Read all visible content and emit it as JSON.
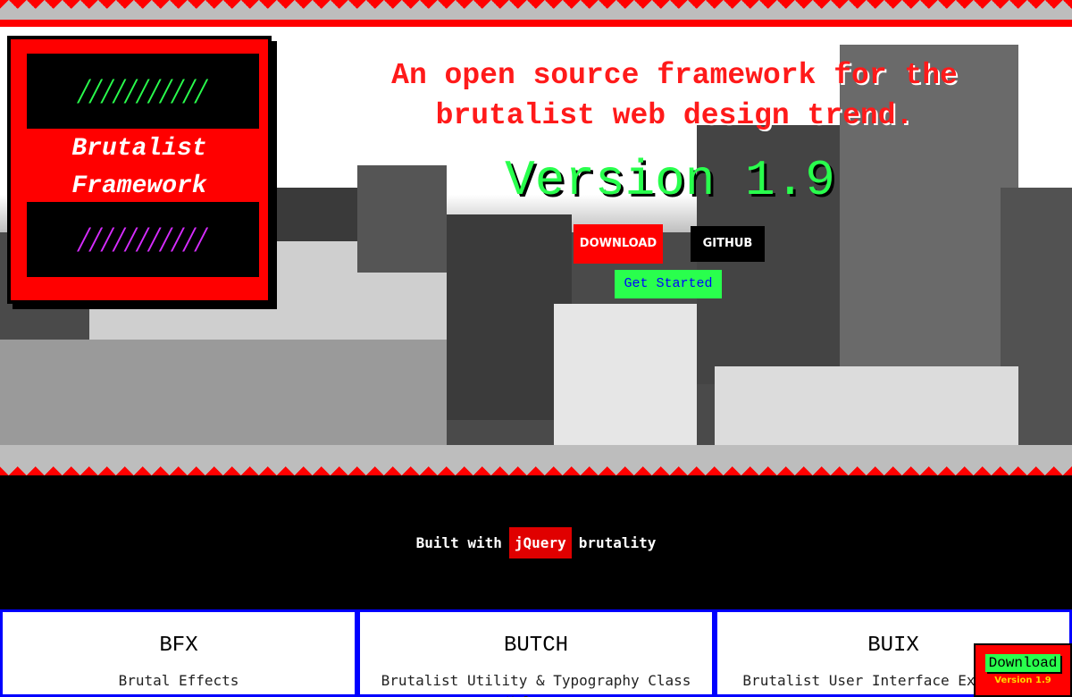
{
  "logo": {
    "slashes_top": "///////////",
    "title_line1": "Brutalist",
    "title_line2": "Framework",
    "slashes_bottom": "///////////"
  },
  "hero": {
    "tagline_line1": "An open source framework for the",
    "tagline_line2": "brutalist web design trend.",
    "version": "Version 1.9",
    "download_label": "DOWNLOAD",
    "github_label": "GITHUB",
    "get_started_label": "Get Started"
  },
  "built_with": {
    "prefix": "Built with",
    "highlight": "jQuery",
    "suffix": "brutality"
  },
  "cards": [
    {
      "title": "BFX",
      "subtitle": "Brutal Effects"
    },
    {
      "title": "BUTCH",
      "subtitle": "Brutalist Utility & Typography Class Helpers"
    },
    {
      "title": "BUIX",
      "subtitle": "Brutalist User Interface Extensions"
    }
  ],
  "floating_download": {
    "label": "Download",
    "version": "Version 1.9"
  },
  "colors": {
    "accent_red": "#ff0000",
    "accent_green": "#29ff4d",
    "accent_magenta": "#d62cff",
    "card_border_blue": "#0000ff"
  }
}
